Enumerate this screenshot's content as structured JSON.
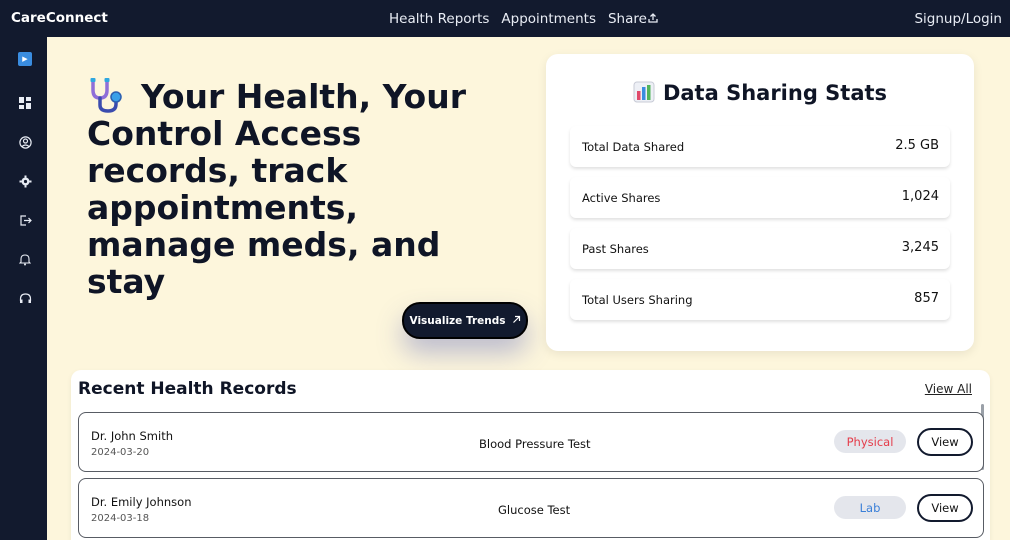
{
  "header": {
    "brand": "CareConnect",
    "nav": [
      "Health Reports",
      "Appointments",
      "Share"
    ],
    "share_icon": "share-upload-icon",
    "signup": "Signup/Login"
  },
  "sidebar": {
    "icons": [
      "play-icon",
      "dashboard-icon",
      "user-circle-icon",
      "gear-icon",
      "logout-icon",
      "bell-icon",
      "support-icon"
    ]
  },
  "hero": {
    "icon": "stethoscope-icon",
    "title": "Your Health, Your Control Access records, track appointments, manage meds, and stay",
    "button": "Visualize Trends",
    "button_icon": "arrow-up-right-icon"
  },
  "stats": {
    "icon": "bar-chart-icon",
    "title": "Data Sharing Stats",
    "rows": [
      {
        "label": "Total Data Shared",
        "value": "2.5 GB"
      },
      {
        "label": "Active Shares",
        "value": "1,024"
      },
      {
        "label": "Past Shares",
        "value": "3,245"
      },
      {
        "label": "Total Users Sharing",
        "value": "857"
      }
    ]
  },
  "records": {
    "title": "Recent Health Records",
    "view_all": "View All",
    "rows": [
      {
        "doctor": "Dr. John Smith",
        "date": "2024-03-20",
        "test": "Blood Pressure Test",
        "type": "Physical",
        "action": "View"
      },
      {
        "doctor": "Dr. Emily Johnson",
        "date": "2024-03-18",
        "test": "Glucose Test",
        "type": "Lab",
        "action": "View"
      }
    ]
  },
  "colors": {
    "navy": "#121a2e",
    "background": "#fdf6dc",
    "physical_badge": "#e53c4a",
    "lab_badge": "#3a7fd8",
    "sidebar_active": "#3a8de0"
  }
}
